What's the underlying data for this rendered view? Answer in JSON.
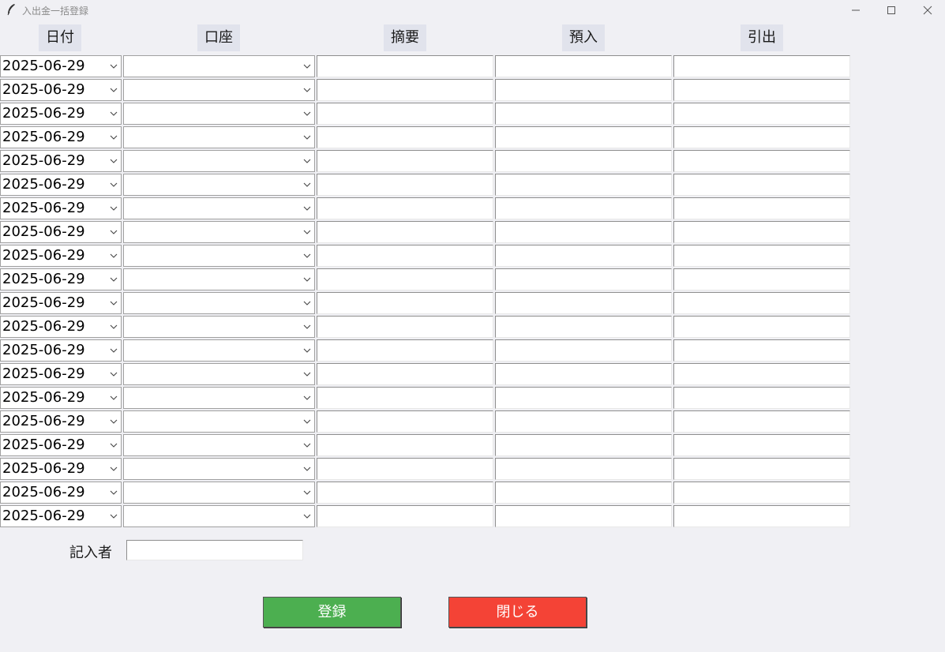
{
  "window": {
    "title": "入出金一括登録",
    "controls": [
      "minimize-icon",
      "maximize-icon",
      "close-icon"
    ]
  },
  "columns": {
    "date": "日付",
    "account": "口座",
    "memo": "摘要",
    "deposit": "預入",
    "withdrawal": "引出"
  },
  "rows": [
    {
      "date": "2025-06-29",
      "account": "",
      "memo": "",
      "deposit": "",
      "withdrawal": ""
    },
    {
      "date": "2025-06-29",
      "account": "",
      "memo": "",
      "deposit": "",
      "withdrawal": ""
    },
    {
      "date": "2025-06-29",
      "account": "",
      "memo": "",
      "deposit": "",
      "withdrawal": ""
    },
    {
      "date": "2025-06-29",
      "account": "",
      "memo": "",
      "deposit": "",
      "withdrawal": ""
    },
    {
      "date": "2025-06-29",
      "account": "",
      "memo": "",
      "deposit": "",
      "withdrawal": ""
    },
    {
      "date": "2025-06-29",
      "account": "",
      "memo": "",
      "deposit": "",
      "withdrawal": ""
    },
    {
      "date": "2025-06-29",
      "account": "",
      "memo": "",
      "deposit": "",
      "withdrawal": ""
    },
    {
      "date": "2025-06-29",
      "account": "",
      "memo": "",
      "deposit": "",
      "withdrawal": ""
    },
    {
      "date": "2025-06-29",
      "account": "",
      "memo": "",
      "deposit": "",
      "withdrawal": ""
    },
    {
      "date": "2025-06-29",
      "account": "",
      "memo": "",
      "deposit": "",
      "withdrawal": ""
    },
    {
      "date": "2025-06-29",
      "account": "",
      "memo": "",
      "deposit": "",
      "withdrawal": ""
    },
    {
      "date": "2025-06-29",
      "account": "",
      "memo": "",
      "deposit": "",
      "withdrawal": ""
    },
    {
      "date": "2025-06-29",
      "account": "",
      "memo": "",
      "deposit": "",
      "withdrawal": ""
    },
    {
      "date": "2025-06-29",
      "account": "",
      "memo": "",
      "deposit": "",
      "withdrawal": ""
    },
    {
      "date": "2025-06-29",
      "account": "",
      "memo": "",
      "deposit": "",
      "withdrawal": ""
    },
    {
      "date": "2025-06-29",
      "account": "",
      "memo": "",
      "deposit": "",
      "withdrawal": ""
    },
    {
      "date": "2025-06-29",
      "account": "",
      "memo": "",
      "deposit": "",
      "withdrawal": ""
    },
    {
      "date": "2025-06-29",
      "account": "",
      "memo": "",
      "deposit": "",
      "withdrawal": ""
    },
    {
      "date": "2025-06-29",
      "account": "",
      "memo": "",
      "deposit": "",
      "withdrawal": ""
    },
    {
      "date": "2025-06-29",
      "account": "",
      "memo": "",
      "deposit": "",
      "withdrawal": ""
    }
  ],
  "recorder": {
    "label": "記入者",
    "value": ""
  },
  "actions": {
    "register": {
      "label": "登録",
      "color": "#4caf50"
    },
    "close": {
      "label": "閉じる",
      "color": "#f44336"
    }
  },
  "colors": {
    "background": "#f0f0f4",
    "header_bg": "#e1e3ec"
  }
}
